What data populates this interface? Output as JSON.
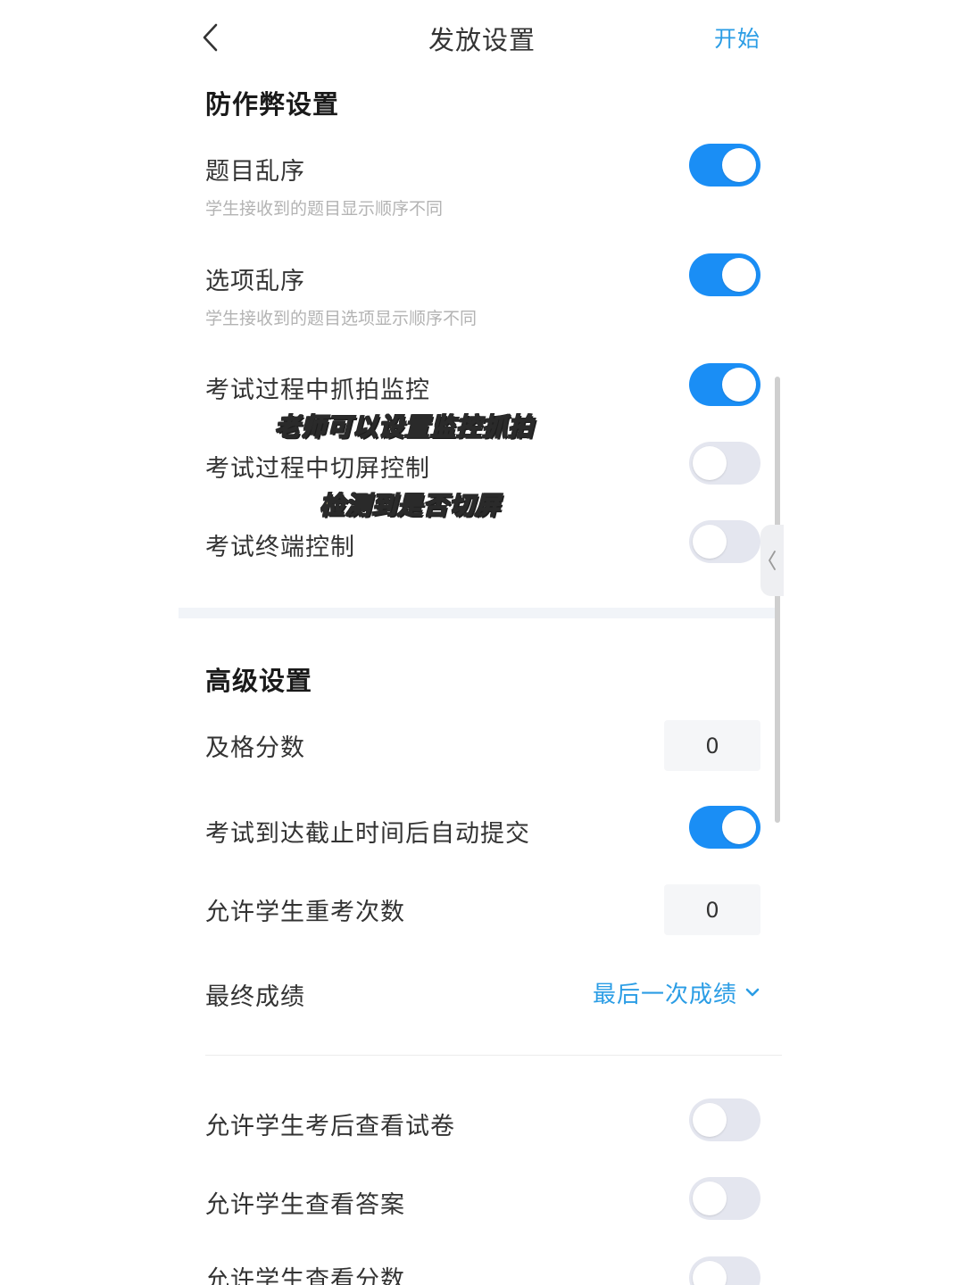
{
  "header": {
    "title": "发放设置",
    "start_label": "开始"
  },
  "anti_cheat": {
    "section_title": "防作弊设置",
    "items": [
      {
        "label": "题目乱序",
        "description": "学生接收到的题目显示顺序不同",
        "enabled": true
      },
      {
        "label": "选项乱序",
        "description": "学生接收到的题目选项显示顺序不同",
        "enabled": true
      },
      {
        "label": "考试过程中抓拍监控",
        "enabled": true
      },
      {
        "label": "考试过程中切屏控制",
        "enabled": false
      },
      {
        "label": "考试终端控制",
        "enabled": false
      }
    ]
  },
  "captions": {
    "monitoring": "老师可以设置监控抓拍",
    "switch_screen": "检测到是否切屏"
  },
  "advanced": {
    "section_title": "高级设置",
    "passing_score": {
      "label": "及格分数",
      "value": "0"
    },
    "auto_submit": {
      "label": "考试到达截止时间后自动提交",
      "enabled": true
    },
    "retake_count": {
      "label": "允许学生重考次数",
      "value": "0"
    },
    "final_score": {
      "label": "最终成绩",
      "value": "最后一次成绩"
    },
    "view_items": [
      {
        "label": "允许学生考后查看试卷",
        "enabled": false
      },
      {
        "label": "允许学生查看答案",
        "enabled": false
      },
      {
        "label": "允许学生查看分数",
        "enabled": false
      }
    ]
  },
  "colors": {
    "accent": "#2b9de5",
    "toggle_on": "#1a8ef5",
    "toggle_off": "#e4e6ef"
  }
}
